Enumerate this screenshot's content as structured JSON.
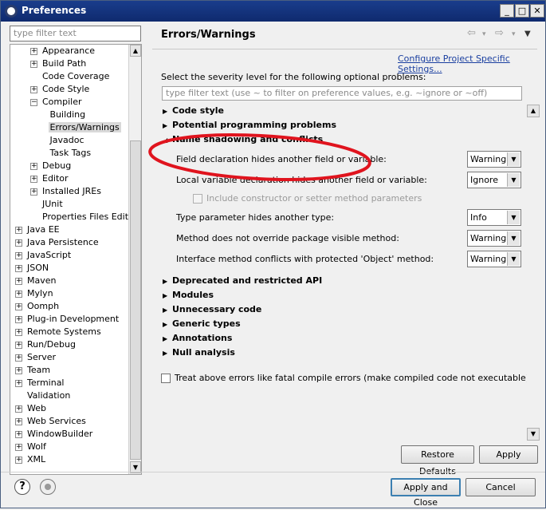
{
  "window": {
    "title": "Preferences",
    "controls": [
      "_",
      "□",
      "✕"
    ]
  },
  "left": {
    "filter_placeholder": "type filter text",
    "tree": [
      {
        "label": "Appearance",
        "indent": 2,
        "expand": "+"
      },
      {
        "label": "Build Path",
        "indent": 2,
        "expand": "+"
      },
      {
        "label": "Code Coverage",
        "indent": 2,
        "expand": ""
      },
      {
        "label": "Code Style",
        "indent": 2,
        "expand": "+"
      },
      {
        "label": "Compiler",
        "indent": 2,
        "expand": "-"
      },
      {
        "label": "Building",
        "indent": 3,
        "expand": ""
      },
      {
        "label": "Errors/Warnings",
        "indent": 3,
        "expand": "",
        "selected": true
      },
      {
        "label": "Javadoc",
        "indent": 3,
        "expand": ""
      },
      {
        "label": "Task Tags",
        "indent": 3,
        "expand": ""
      },
      {
        "label": "Debug",
        "indent": 2,
        "expand": "+"
      },
      {
        "label": "Editor",
        "indent": 2,
        "expand": "+"
      },
      {
        "label": "Installed JREs",
        "indent": 2,
        "expand": "+"
      },
      {
        "label": "JUnit",
        "indent": 2,
        "expand": ""
      },
      {
        "label": "Properties Files Editor",
        "indent": 2,
        "expand": ""
      },
      {
        "label": "Java EE",
        "indent": 0,
        "expand": "+"
      },
      {
        "label": "Java Persistence",
        "indent": 0,
        "expand": "+"
      },
      {
        "label": "JavaScript",
        "indent": 0,
        "expand": "+"
      },
      {
        "label": "JSON",
        "indent": 0,
        "expand": "+"
      },
      {
        "label": "Maven",
        "indent": 0,
        "expand": "+"
      },
      {
        "label": "Mylyn",
        "indent": 0,
        "expand": "+"
      },
      {
        "label": "Oomph",
        "indent": 0,
        "expand": "+"
      },
      {
        "label": "Plug-in Development",
        "indent": 0,
        "expand": "+"
      },
      {
        "label": "Remote Systems",
        "indent": 0,
        "expand": "+"
      },
      {
        "label": "Run/Debug",
        "indent": 0,
        "expand": "+"
      },
      {
        "label": "Server",
        "indent": 0,
        "expand": "+"
      },
      {
        "label": "Team",
        "indent": 0,
        "expand": "+"
      },
      {
        "label": "Terminal",
        "indent": 0,
        "expand": "+"
      },
      {
        "label": "Validation",
        "indent": 0,
        "expand": ""
      },
      {
        "label": "Web",
        "indent": 0,
        "expand": "+"
      },
      {
        "label": "Web Services",
        "indent": 0,
        "expand": "+"
      },
      {
        "label": "WindowBuilder",
        "indent": 0,
        "expand": "+"
      },
      {
        "label": "Wolf",
        "indent": 0,
        "expand": "+"
      },
      {
        "label": "XML",
        "indent": 0,
        "expand": "+"
      }
    ]
  },
  "right": {
    "title": "Errors/Warnings",
    "nav": {
      "back": "⇦",
      "back_menu": "▾",
      "forward": "⇨",
      "forward_menu": "▾",
      "view_menu": "▼"
    },
    "configure_link": "Configure Project Specific Settings...",
    "severity_label": "Select the severity level for the following optional problems:",
    "severity_filter_placeholder": "type filter text (use ~ to filter on preference values, e.g. ~ignore or ~off)",
    "sections": {
      "code_style": "Code style",
      "potential": "Potential programming problems",
      "shadowing": "Name shadowing and conflicts",
      "deprecated": "Deprecated and restricted API",
      "modules": "Modules",
      "unnecessary": "Unnecessary code",
      "generic": "Generic types",
      "annotations": "Annotations",
      "null": "Null analysis"
    },
    "options": {
      "field_hides": {
        "label": "Field declaration hides another field or variable:",
        "value": "Warning"
      },
      "local_hides": {
        "label": "Local variable declaration hides another field or variable:",
        "value": "Ignore"
      },
      "include_ctor": {
        "label": "Include constructor or setter method parameters"
      },
      "type_param": {
        "label": "Type parameter hides another type:",
        "value": "Info"
      },
      "method_override": {
        "label": "Method does not override package visible method:",
        "value": "Warning"
      },
      "interface_conflict": {
        "label": "Interface method conflicts with protected 'Object' method:",
        "value": "Warning"
      }
    },
    "treat_errors": "Treat above errors like fatal compile errors (make compiled code not executable)",
    "restore_defaults": "Restore Defaults",
    "apply": "Apply"
  },
  "bottom": {
    "apply_close": "Apply and Close",
    "cancel": "Cancel"
  },
  "colors": {
    "title_bar": "#0f2a6e",
    "link": "#1a3fa0",
    "annotation_oval": "#e0141e"
  }
}
